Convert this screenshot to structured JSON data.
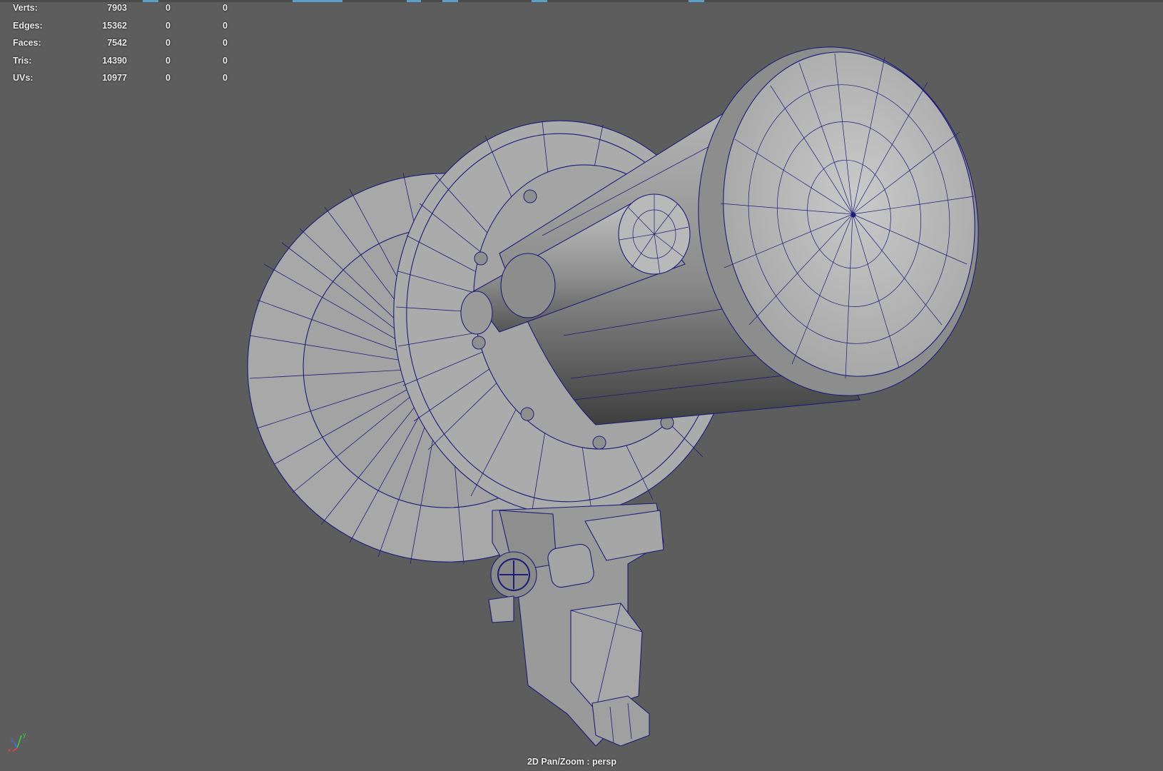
{
  "hud": {
    "rows": [
      {
        "label": "Verts:",
        "v1": "7903",
        "v2": "0",
        "v3": "0"
      },
      {
        "label": "Edges:",
        "v1": "15362",
        "v2": "0",
        "v3": "0"
      },
      {
        "label": "Faces:",
        "v1": "7542",
        "v2": "0",
        "v3": "0"
      },
      {
        "label": "Tris:",
        "v1": "14390",
        "v2": "0",
        "v3": "0"
      },
      {
        "label": "UVs:",
        "v1": "10977",
        "v2": "0",
        "v3": "0"
      }
    ]
  },
  "viewport": {
    "camera_label": "2D Pan/Zoom : persp",
    "background_color": "#5d5d5d",
    "wireframe_color": "#1c1c7a",
    "shaded_color": "#a9a9a9"
  },
  "axis_indicator": {
    "labels": [
      "y",
      "z",
      "x"
    ],
    "colors": [
      "#3bd23b",
      "#3b6bff",
      "#ff3b3b"
    ]
  }
}
